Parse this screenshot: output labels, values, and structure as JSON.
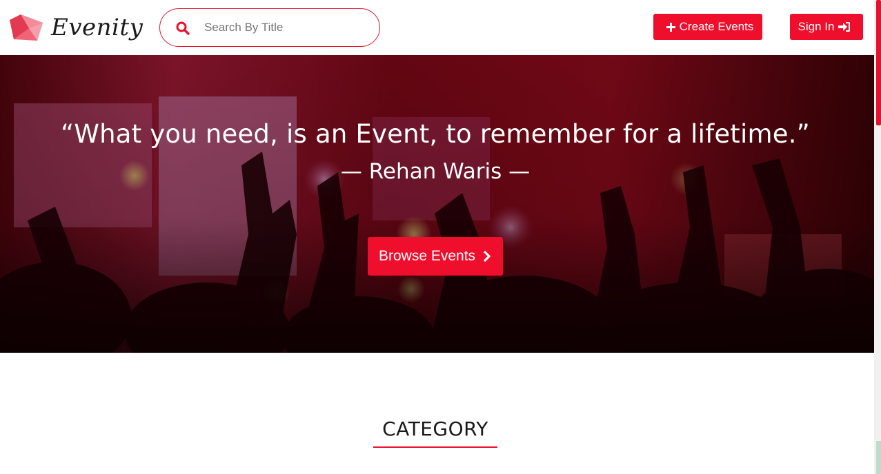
{
  "brand": {
    "name": "Evenity",
    "accent": "#ef0e2b"
  },
  "search": {
    "placeholder": "Search By Title",
    "value": ""
  },
  "header": {
    "create_label": "Create Events",
    "signin_label": "Sign In",
    "create_icon": "plus-icon",
    "signin_icon": "sign-in-icon"
  },
  "hero": {
    "quote": "“What you need, is an Event, to remember for a lifetime.”",
    "author": "— Rehan Waris —",
    "cta_label": "Browse Events",
    "cta_icon": "chevron-right-icon"
  },
  "sections": {
    "category_title": "CATEGORY"
  }
}
